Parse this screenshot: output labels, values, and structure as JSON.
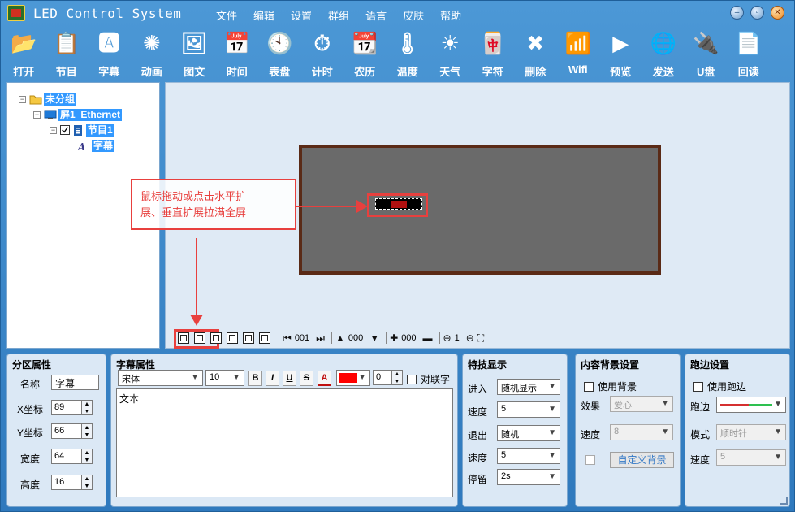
{
  "window": {
    "title": "LED Control System",
    "menu": [
      "文件",
      "编辑",
      "设置",
      "群组",
      "语言",
      "皮肤",
      "帮助"
    ],
    "controls": [
      "minimize-icon",
      "restore-icon",
      "close-icon"
    ]
  },
  "toolbar": [
    {
      "label": "打开",
      "icon": "folder-open-icon",
      "glyph": "📂"
    },
    {
      "label": "节目",
      "icon": "program-list-icon",
      "glyph": "📋"
    },
    {
      "label": "字幕",
      "icon": "subtitle-icon",
      "glyph": "🅰"
    },
    {
      "label": "动画",
      "icon": "animation-icon",
      "glyph": "✺"
    },
    {
      "label": "图文",
      "icon": "image-text-icon",
      "glyph": "🖼"
    },
    {
      "label": "时间",
      "icon": "calendar-time-icon",
      "glyph": "📅"
    },
    {
      "label": "表盘",
      "icon": "clock-dial-icon",
      "glyph": "🕙"
    },
    {
      "label": "计时",
      "icon": "timer-icon",
      "glyph": "⏱"
    },
    {
      "label": "农历",
      "icon": "lunar-calendar-icon",
      "glyph": "📆"
    },
    {
      "label": "温度",
      "icon": "thermometer-icon",
      "glyph": "🌡"
    },
    {
      "label": "天气",
      "icon": "sun-weather-icon",
      "glyph": "☀"
    },
    {
      "label": "字符",
      "icon": "character-icon",
      "glyph": "🀄"
    },
    {
      "label": "删除",
      "icon": "delete-x-icon",
      "glyph": "✖"
    },
    {
      "label": "Wifi",
      "icon": "wifi-icon",
      "glyph": "📶"
    },
    {
      "label": "预览",
      "icon": "preview-play-icon",
      "glyph": "▶"
    },
    {
      "label": "发送",
      "icon": "send-icon",
      "glyph": "🌐"
    },
    {
      "label": "U盘",
      "icon": "usb-drive-icon",
      "glyph": "🔌"
    },
    {
      "label": "回读",
      "icon": "readback-icon",
      "glyph": "📄"
    }
  ],
  "tree": {
    "root": "未分组",
    "screen": "屏1_Ethernet",
    "program": "节目1",
    "item": "字幕"
  },
  "canvas": {
    "callout_line1": "鼠标拖动或点击水平扩",
    "callout_line2": "展、垂直扩展拉满全屏",
    "toolbar_values": {
      "frame": "001",
      "h_value": "000",
      "v_value": "000",
      "zoom": "1"
    }
  },
  "partition": {
    "title": "分区属性",
    "name_label": "名称",
    "name_value": "字幕",
    "x_label": "X坐标",
    "x_value": "89",
    "y_label": "Y坐标",
    "y_value": "66",
    "width_label": "宽度",
    "width_value": "64",
    "height_label": "高度",
    "height_value": "16"
  },
  "subtitle": {
    "title": "字幕属性",
    "font": "宋体",
    "size": "10",
    "bold": "B",
    "italic": "I",
    "underline": "U",
    "strike": "S",
    "color_letter": "A",
    "text_color": "#ff0000",
    "spacing": "0",
    "couplet_label": "对联字",
    "text": "文本"
  },
  "effects": {
    "title": "特技显示",
    "enter_label": "进入",
    "enter_value": "随机显示",
    "speed1_label": "速度",
    "speed1_value": "5",
    "exit_label": "退出",
    "exit_value": "随机",
    "speed2_label": "速度",
    "speed2_value": "5",
    "stay_label": "停留",
    "stay_value": "2s"
  },
  "background": {
    "title": "内容背景设置",
    "use_bg_label": "使用背景",
    "effect_label": "效果",
    "effect_value": "爱心",
    "speed_label": "速度",
    "speed_value": "8",
    "custom_button": "自定义背景"
  },
  "border": {
    "title": "跑边设置",
    "use_border_label": "使用跑边",
    "border_label": "跑边",
    "mode_label": "模式",
    "mode_value": "顺时针",
    "speed_label": "速度",
    "speed_value": "5"
  }
}
